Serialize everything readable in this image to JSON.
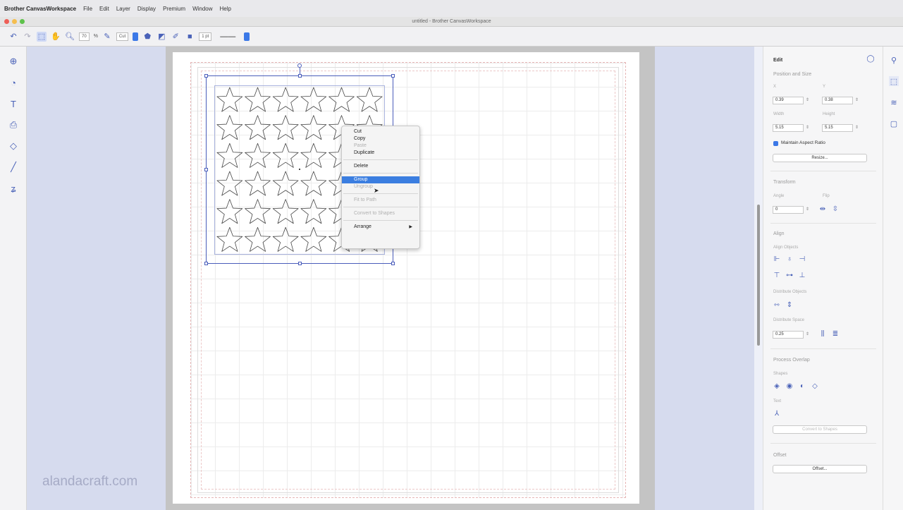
{
  "menubar": {
    "app": "Brother CanvasWorkspace",
    "items": [
      "File",
      "Edit",
      "Layer",
      "Display",
      "Premium",
      "Window",
      "Help"
    ]
  },
  "window": {
    "title": "untitled - Brother CanvasWorkspace"
  },
  "toolbar": {
    "zoom_value": "70",
    "zoom_unit": "%",
    "mode_label": "Cut",
    "line_width": "1",
    "line_unit": "pt"
  },
  "context_menu": {
    "cut": "Cut",
    "copy": "Copy",
    "paste": "Paste",
    "duplicate": "Duplicate",
    "delete": "Delete",
    "group": "Group",
    "ungroup": "Ungroup",
    "fit_to_path": "Fit to Path",
    "convert_to_shapes": "Convert to Shapes",
    "arrange": "Arrange"
  },
  "panel": {
    "title": "Edit",
    "position_size": {
      "heading": "Position and Size",
      "x_label": "X",
      "y_label": "Y",
      "x": "0.39",
      "y": "0.38",
      "width_label": "Width",
      "height_label": "Height",
      "width": "5.15",
      "height": "5.15",
      "maintain_aspect": "Maintain Aspect Ratio",
      "resize_button": "Resize..."
    },
    "transform": {
      "heading": "Transform",
      "angle_label": "Angle",
      "flip_label": "Flip",
      "angle": "0"
    },
    "align": {
      "heading": "Align",
      "align_objects": "Align Objects",
      "distribute_objects": "Distribute Objects",
      "distribute_space": "Distribute Space",
      "space_value": "0.25"
    },
    "process_overlap": {
      "heading": "Process Overlap",
      "shapes_label": "Shapes",
      "text_label": "Text",
      "convert_button": "Convert to Shapes"
    },
    "offset": {
      "heading": "Offset",
      "button": "Offset..."
    }
  },
  "watermark": "alandacraft.com",
  "colors": {
    "accent": "#3b7ee0",
    "selection": "#4a5dbb",
    "canvas_bg": "#d6dbee"
  }
}
